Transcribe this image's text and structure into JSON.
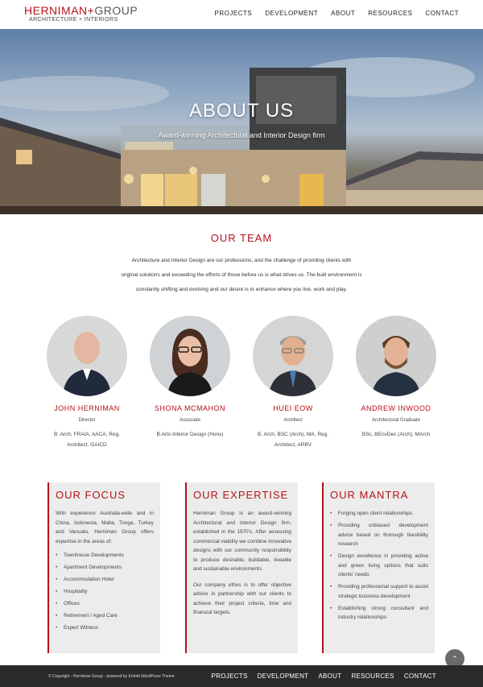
{
  "logo": {
    "main_left": "HERNIMAN",
    "plus": "+",
    "main_right": "GROUP",
    "sub": "ARCHITECTURE + INTERIORS"
  },
  "nav": [
    "PROJECTS",
    "DEVELOPMENT",
    "ABOUT",
    "RESOURCES",
    "CONTACT"
  ],
  "hero": {
    "title": "ABOUT US",
    "subtitle": "Award-winning Architectural and Interior Design firm"
  },
  "team": {
    "heading": "OUR TEAM",
    "intro_lines": [
      "Architecture and Interior Design are our professions, and the challenge of providing clients with",
      "original solutions and exceeding the efforts of those before us is what drives us. The built environment is",
      "constantly shifting and evolving and our desire is to enhance where you live, work and play."
    ],
    "members": [
      {
        "name": "JOHN HERNIMAN",
        "role": "Director",
        "quals": "B. Arch, FRAIA, AACA, Reg. Architect, GAICD"
      },
      {
        "name": "SHONA MCMAHON",
        "role": "Associate",
        "quals": "B.Arts Interior Design (Hons)"
      },
      {
        "name": "HUEI EOW",
        "role": "Architect",
        "quals": "B. Arch, BSC (Arch), MA, Reg. Architect, ARBV"
      },
      {
        "name": "ANDREW INWOOD",
        "role": "Architectural Graduate",
        "quals": "BSc, BEnvDec (Arch), MArch"
      }
    ]
  },
  "focus": {
    "title": "OUR FOCUS",
    "text": "With experience Australia-wide and in China, Indonesia, Malta, Tonga, Turkey and Vanuatu, Herniman Group offers expertise in the areas of:",
    "items": [
      "Townhouse Developments",
      "Apartment Developments",
      "Accommodation Hotel",
      "Hospitality",
      "Offices",
      "Retirement / Aged Care",
      "Expert Witness"
    ]
  },
  "expertise": {
    "title": "OUR EXPERTISE",
    "p1": "Herniman Group is an award-winning Architectural and Interior Design firm, established in the 1970's. After assessing commercial viability we combine innovative designs with our community responsibility to produce desirable, buildable, liveable and sustainable environments.",
    "p2": "Our company ethos is to offer objective advice in partnership with our clients to achieve their project criteria, time and financial targets."
  },
  "mantra": {
    "title": "OUR MANTRA",
    "items": [
      "Forging open client relationships",
      "Providing unbiased development advice based on thorough feasibility research",
      "Design excellence in providing active and green living options that suits clients' needs",
      "Providing professional support to assist strategic business development",
      "Establishing strong consultant and industry relationships"
    ]
  },
  "footer": {
    "copyright": "© Copyright - Herniman Group - powered by Enfold WordPress Theme",
    "nav": [
      "PROJECTS",
      "DEVELOPMENT",
      "ABOUT",
      "RESOURCES",
      "CONTACT"
    ],
    "scroll_top_icon": "chevron-up-icon"
  },
  "colors": {
    "accent": "#b5121b",
    "footer_bg": "#2a2a2a",
    "box_bg": "#ececec"
  }
}
